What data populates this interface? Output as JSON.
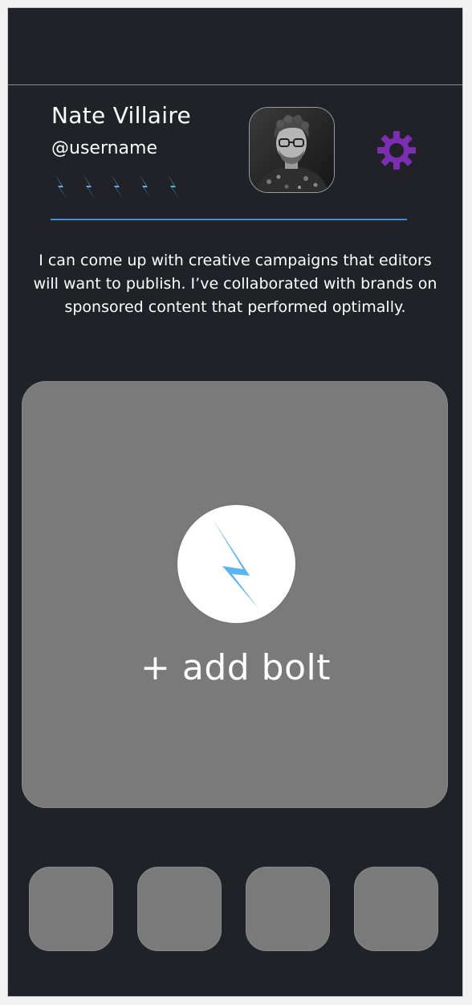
{
  "profile": {
    "name": "Nate Villaire",
    "username": "@username",
    "rating": 5,
    "bio": "I can come up with creative campaigns that editors will want to publish. I’ve collaborated with brands on sponsored content that performed optimally."
  },
  "icons": {
    "settings": "gear-icon",
    "bolt": "lightning-bolt-icon"
  },
  "colors": {
    "background": "#212227",
    "accent_blue": "#3a8fe0",
    "bolt_blue": "#5ab4f0",
    "gear_purple": "#7b2fb0",
    "card_gray": "#7a7a7a"
  },
  "add_card": {
    "label": "+ add bolt"
  },
  "thumbnails": [
    {
      "id": "thumb-1"
    },
    {
      "id": "thumb-2"
    },
    {
      "id": "thumb-3"
    },
    {
      "id": "thumb-4"
    }
  ]
}
